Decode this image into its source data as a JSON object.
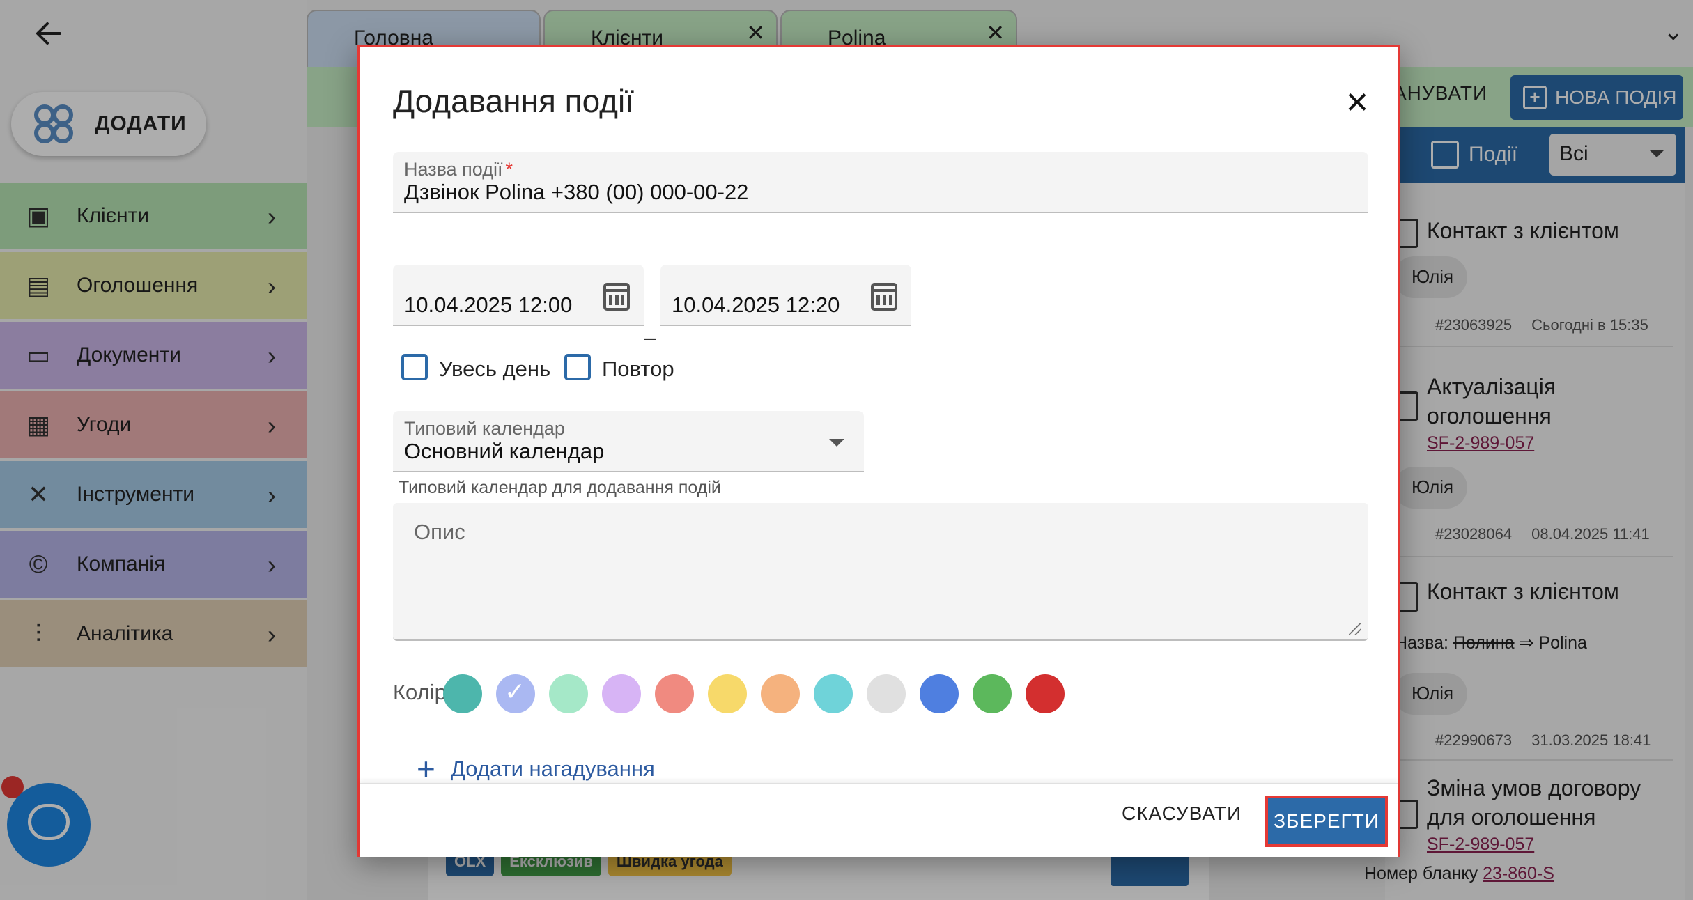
{
  "sidebar": {
    "back_icon": "arrow-left-icon",
    "add_label": "ДОДАТИ",
    "items": [
      {
        "label": "Клієнти",
        "icon": "contacts-icon",
        "color": "#b8e6b6"
      },
      {
        "label": "Оголошення",
        "icon": "listing-icon",
        "color": "#e8ecae"
      },
      {
        "label": "Документи",
        "icon": "folder-icon",
        "color": "#cdb9ea"
      },
      {
        "label": "Угоди",
        "icon": "money-icon",
        "color": "#eeb3b3"
      },
      {
        "label": "Інструменти",
        "icon": "tools-icon",
        "color": "#a9cde9"
      },
      {
        "label": "Компанія",
        "icon": "copyright-icon",
        "color": "#b9b7ea"
      },
      {
        "label": "Аналітика",
        "icon": "analytics-icon",
        "color": "#e3d2b7"
      }
    ]
  },
  "tabs": [
    {
      "label": "Головна"
    },
    {
      "label": "Клієнти"
    },
    {
      "label": "Polina"
    }
  ],
  "toolbar": {
    "cancel_plan_label": "АНУВАТИ",
    "new_event_label": "НОВА ПОДІЯ"
  },
  "right_panel": {
    "events_label": "Події",
    "filter_value": "Всі",
    "events": [
      {
        "title": "Контакт з клієнтом",
        "user": "Юлія",
        "id": "#23063925",
        "date": "Сьогодні в 15:35"
      },
      {
        "title_line1": "Актуалізація",
        "title_line2": "оголошення",
        "link": "SF-2-989-057",
        "user": "Юлія",
        "id": "#23028064",
        "date": "08.04.2025 11:41"
      },
      {
        "title": "Контакт з клієнтом",
        "name_change_prefix": "Назва:",
        "old_name": "Полина",
        "arrow": "⇒",
        "new_name": "Polina",
        "user": "Юлія",
        "id": "#22990673",
        "date": "31.03.2025 18:41"
      },
      {
        "title_line1": "Зміна умов договору",
        "title_line2": "для оголошення",
        "link": "SF-2-989-057",
        "blank_label": "Номер бланку",
        "blank_no": "23-860-S"
      }
    ]
  },
  "badges": [
    {
      "label": "OLX",
      "color": "#2c6aa8"
    },
    {
      "label": "Ексклюзив",
      "color": "#43a047"
    },
    {
      "label": "Швидка угода",
      "color": "#f9c846"
    }
  ],
  "modal": {
    "title": "Додавання події",
    "name_field": {
      "label": "Назва події",
      "required_mark": "*",
      "value": "Дзвінок Polina +380 (00) 000-00-22"
    },
    "start_datetime": "10.04.2025 12:00",
    "end_datetime": "10.04.2025 12:20",
    "range_dash": "–",
    "all_day_label": "Увесь день",
    "repeat_label": "Повтор",
    "calendar_field": {
      "label": "Типовий календар",
      "value": "Основний календар",
      "hint": "Типовий календар для додавання подій"
    },
    "description_placeholder": "Опис",
    "color_label": "Колір:",
    "colors": [
      "#4db6ac",
      "#aab8f2",
      "#a5e8c8",
      "#d7b4f5",
      "#f08a80",
      "#f7d96a",
      "#f5b27e",
      "#6fd3d9",
      "#e0e0e0",
      "#4f7fe0",
      "#5cb85c",
      "#d32f2f"
    ],
    "selected_color_index": 1,
    "add_reminder_label": "Додати нагадування",
    "cancel_label": "СКАСУВАТИ",
    "save_label": "ЗБЕРЕГТИ"
  }
}
